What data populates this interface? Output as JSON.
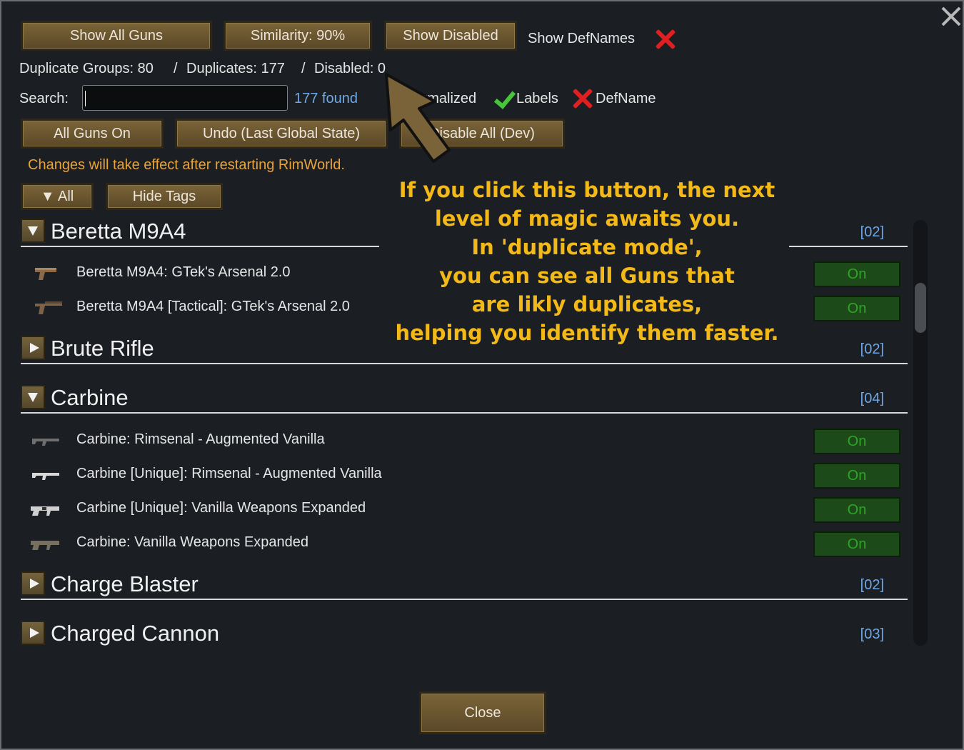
{
  "toolbar": {
    "show_all_guns": "Show All Guns",
    "similarity": "Similarity: 90%",
    "show_disabled": "Show Disabled",
    "show_defnames": "Show DefNames"
  },
  "stats": {
    "duplicate_groups": "Duplicate Groups: 80",
    "sep1": "/",
    "duplicates": "Duplicates: 177",
    "sep2": "/",
    "disabled": "Disabled: 0"
  },
  "search": {
    "label": "Search:",
    "value": "",
    "found": "177 found",
    "normalized": "Normalized",
    "labels": "Labels",
    "defname": "DefName"
  },
  "actions": {
    "all_on": "All Guns On",
    "undo": "Undo (Last Global State)",
    "disable_all": "Disable All (Dev)"
  },
  "notice": "Changes will take effect after restarting RimWorld.",
  "filters": {
    "all": "▼ All",
    "hide_tags": "Hide Tags"
  },
  "groups": [
    {
      "name": "Beretta M9A4",
      "count": "[02]",
      "expanded": true,
      "items": [
        {
          "label": "Beretta M9A4: GTek's Arsenal 2.0",
          "state": "On",
          "icon": "pistol-icon"
        },
        {
          "label": "Beretta M9A4 [Tactical]: GTek's Arsenal 2.0",
          "state": "On",
          "icon": "pistol-icon"
        }
      ]
    },
    {
      "name": "Brute Rifle",
      "count": "[02]",
      "expanded": false,
      "items": []
    },
    {
      "name": "Carbine",
      "count": "[04]",
      "expanded": true,
      "items": [
        {
          "label": "Carbine: Rimsenal - Augmented Vanilla",
          "state": "On",
          "icon": "rifle-icon"
        },
        {
          "label": "Carbine [Unique]: Rimsenal - Augmented Vanilla",
          "state": "On",
          "icon": "rifle-icon"
        },
        {
          "label": "Carbine [Unique]: Vanilla Weapons Expanded",
          "state": "On",
          "icon": "rifle-icon"
        },
        {
          "label": "Carbine: Vanilla Weapons Expanded",
          "state": "On",
          "icon": "rifle-icon"
        }
      ]
    },
    {
      "name": "Charge Blaster",
      "count": "[02]",
      "expanded": false,
      "items": []
    },
    {
      "name": "Charged Cannon",
      "count": "[03]",
      "expanded": false,
      "items": []
    }
  ],
  "annotation": {
    "line1": "If you click this button, the next",
    "line2": "level of magic awaits you.",
    "line3": "In 'duplicate mode',",
    "line4": "you can see all Guns that",
    "line5": "are likly duplicates,",
    "line6": "helping you identify them faster."
  },
  "footer": {
    "close": "Close"
  },
  "colors": {
    "accent_blue": "#6fa8e6",
    "notice_orange": "#e8a33a",
    "annotation_yellow": "#f2b919",
    "on_green": "#2fa62a"
  }
}
